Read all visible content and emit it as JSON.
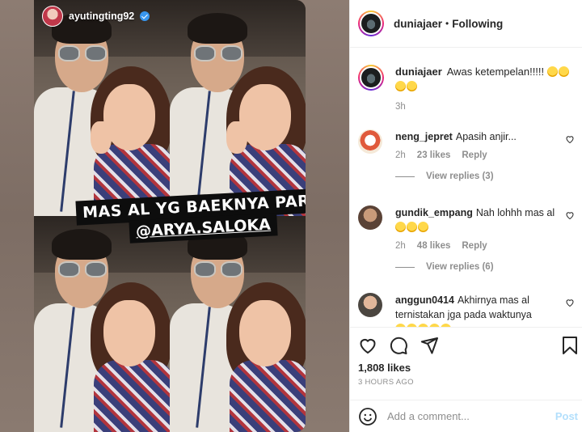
{
  "story": {
    "username": "ayutingting92",
    "caption_line1": "MAS AL YG BAEKNYA PARAH",
    "caption_line2": "@ARYA.SALOKA"
  },
  "post_header": {
    "username": "duniajaer",
    "separator": "•",
    "follow_status": "Following"
  },
  "caption": {
    "username": "duniajaer",
    "text": "Awas ketempelan!!!!!",
    "time": "3h",
    "emoji_count": 4
  },
  "comments": [
    {
      "username": "neng_jepret",
      "text": "Apasih anjir...",
      "time": "2h",
      "likes": "23 likes",
      "reply_label": "Reply",
      "view_replies": "View replies (3)"
    },
    {
      "username": "gundik_empang",
      "text": "Nah lohhh mas al",
      "time": "2h",
      "likes": "48 likes",
      "reply_label": "Reply",
      "view_replies": "View replies (6)"
    },
    {
      "username": "anggun0414",
      "text": "Akhirnya mas al ternistakan jga pada waktunya"
    }
  ],
  "actions": {
    "likes": "1,808 likes",
    "time_ago": "3 HOURS AGO"
  },
  "add_comment": {
    "placeholder": "Add a comment...",
    "post_label": "Post"
  },
  "colors": {
    "accent_link": "#3897f0",
    "post_disabled": "#b2dffc",
    "muted_text": "#8e8e8e"
  }
}
